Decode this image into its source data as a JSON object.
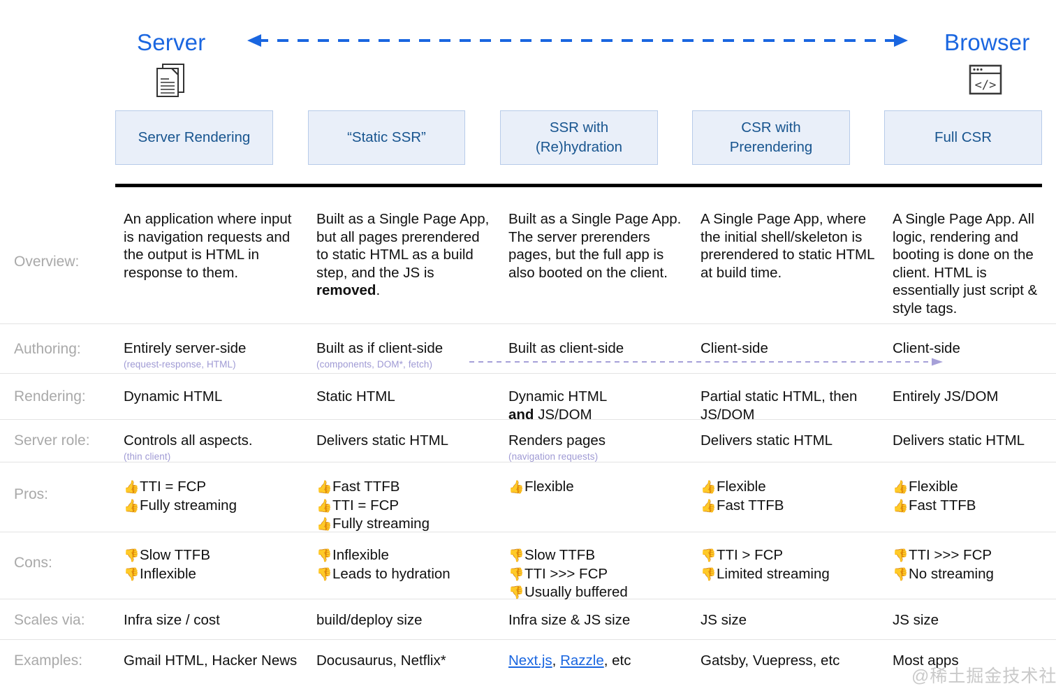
{
  "header": {
    "left_title": "Server",
    "right_title": "Browser",
    "left_icon": "document-icon",
    "right_icon": "browser-code-icon",
    "arrow": "bidirectional-dashed-arrow",
    "arrow_color": "#1a66e0",
    "title_color": "#1a66e0"
  },
  "columns": [
    {
      "label": "Server Rendering"
    },
    {
      "label": "“Static SSR”"
    },
    {
      "label": "SSR with\n(Re)hydration"
    },
    {
      "label": "CSR with\nPrerendering"
    },
    {
      "label": "Full CSR"
    }
  ],
  "column_box_style": {
    "fill": "#e9eff9",
    "border": "#b7cbe9",
    "text": "#18558f"
  },
  "rows": [
    {
      "label": "Overview:",
      "key": "overview",
      "cells": [
        {
          "text": "An application where input is navigation requests and the output is HTML in response to them."
        },
        {
          "text": "Built as a Single Page App, but all pages prerendered to static HTML as a build step, and the JS is ",
          "bold_tail": "removed",
          "tail": "."
        },
        {
          "text": "Built as a Single Page App. The server prerenders pages, but the full app is also booted on the client."
        },
        {
          "text": "A Single Page App, where the initial shell/skeleton is prerendered to static HTML at build time."
        },
        {
          "text": "A Single Page App. All logic, rendering and booting is done on the client. HTML is essentially just script & style tags."
        }
      ]
    },
    {
      "label": "Authoring:",
      "key": "authoring",
      "cells": [
        {
          "text": "Entirely server-side",
          "sub": "(request-response, HTML)"
        },
        {
          "text": "Built as if client-side",
          "sub": "(components, DOM*, fetch)"
        },
        {
          "text": "Built as client-side"
        },
        {
          "text": "Client-side"
        },
        {
          "text": "Client-side"
        }
      ],
      "arrow": {
        "name": "authoring-dashed-arrow",
        "color": "#a6a0d8",
        "direction": "right"
      }
    },
    {
      "label": "Rendering:",
      "key": "rendering",
      "cells": [
        {
          "text": "Dynamic HTML"
        },
        {
          "text": "Static HTML"
        },
        {
          "text": "Dynamic HTML\n",
          "bold_mid": "and",
          "tail2": " JS/DOM"
        },
        {
          "text": "Partial static HTML, then JS/DOM"
        },
        {
          "text": "Entirely JS/DOM"
        }
      ]
    },
    {
      "label": "Server role:",
      "key": "serverrole",
      "cells": [
        {
          "text": "Controls all aspects.",
          "sub": "(thin client)"
        },
        {
          "text": "Delivers static HTML"
        },
        {
          "text": "Renders pages",
          "sub": "(navigation requests)"
        },
        {
          "text": "Delivers static HTML"
        },
        {
          "text": "Delivers static HTML"
        }
      ]
    },
    {
      "label": "Pros:",
      "key": "pros",
      "glyph": "👍",
      "glyph_name": "thumbs-up-icon",
      "cells": [
        {
          "items": [
            "TTI = FCP",
            "Fully streaming"
          ]
        },
        {
          "items": [
            "Fast TTFB",
            "TTI = FCP",
            "Fully streaming"
          ]
        },
        {
          "items": [
            "Flexible"
          ]
        },
        {
          "items": [
            "Flexible",
            "Fast TTFB"
          ]
        },
        {
          "items": [
            "Flexible",
            "Fast TTFB"
          ]
        }
      ]
    },
    {
      "label": "Cons:",
      "key": "cons",
      "glyph": "👎",
      "glyph_name": "thumbs-down-icon",
      "cells": [
        {
          "items": [
            "Slow TTFB",
            "Inflexible"
          ]
        },
        {
          "items": [
            "Inflexible",
            "Leads to hydration"
          ]
        },
        {
          "items": [
            "Slow TTFB",
            "TTI >>> FCP",
            "Usually buffered"
          ]
        },
        {
          "items": [
            "TTI > FCP",
            "Limited streaming"
          ]
        },
        {
          "items": [
            "TTI >>> FCP",
            "No streaming"
          ]
        }
      ]
    },
    {
      "label": "Scales via:",
      "key": "scales",
      "cells": [
        {
          "text": "Infra size / cost"
        },
        {
          "text": "build/deploy size"
        },
        {
          "text": "Infra size & JS size"
        },
        {
          "text": "JS size"
        },
        {
          "text": "JS size"
        }
      ]
    },
    {
      "label": "Examples:",
      "key": "examples",
      "cells": [
        {
          "text": "Gmail HTML, Hacker News"
        },
        {
          "text": "Docusaurus, Netflix*"
        },
        {
          "links": [
            "Next.js",
            "Razzle"
          ],
          "tail": ", etc"
        },
        {
          "text": "Gatsby, Vuepress, etc"
        },
        {
          "text": "Most apps"
        }
      ]
    }
  ],
  "watermark": "@稀土掘金技术社区"
}
